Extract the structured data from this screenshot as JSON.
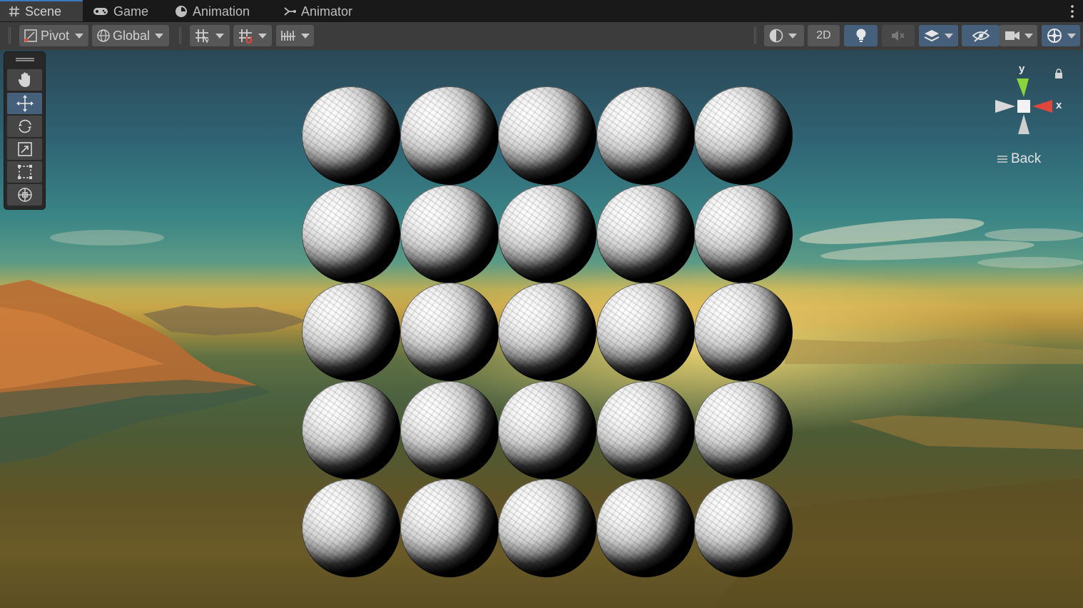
{
  "tabs": [
    {
      "label": "Scene",
      "icon": "grid-hash-icon",
      "active": true
    },
    {
      "label": "Game",
      "icon": "gamepad-icon",
      "active": false
    },
    {
      "label": "Animation",
      "icon": "clock-icon",
      "active": false
    },
    {
      "label": "Animator",
      "icon": "node-graph-icon",
      "active": false
    }
  ],
  "toolbar": {
    "pivot_label": "Pivot",
    "global_label": "Global",
    "mode_2d_label": "2D"
  },
  "tools": [
    {
      "name": "hand-tool",
      "icon": "hand-icon",
      "selected": false
    },
    {
      "name": "move-tool",
      "icon": "move-arrows-icon",
      "selected": true
    },
    {
      "name": "rotate-tool",
      "icon": "rotate-icon",
      "selected": false
    },
    {
      "name": "scale-tool",
      "icon": "scale-icon",
      "selected": false
    },
    {
      "name": "rect-tool",
      "icon": "rect-transform-icon",
      "selected": false
    },
    {
      "name": "transform-tool",
      "icon": "transform-icon",
      "selected": false
    }
  ],
  "gizmo": {
    "y_label": "y",
    "x_label": "x",
    "view_label": "Back",
    "colors": {
      "y": "#8ad33a",
      "x": "#e0473c",
      "neutral": "#d9d9d9"
    }
  },
  "scene": {
    "sphere_rows": 5,
    "sphere_cols": 5,
    "skybox": "mountain-lake-sunset"
  },
  "colors": {
    "accent_blue": "#46607c",
    "tab_active_border": "#3a79bb",
    "toolbar_bg": "#3c3c3c"
  }
}
